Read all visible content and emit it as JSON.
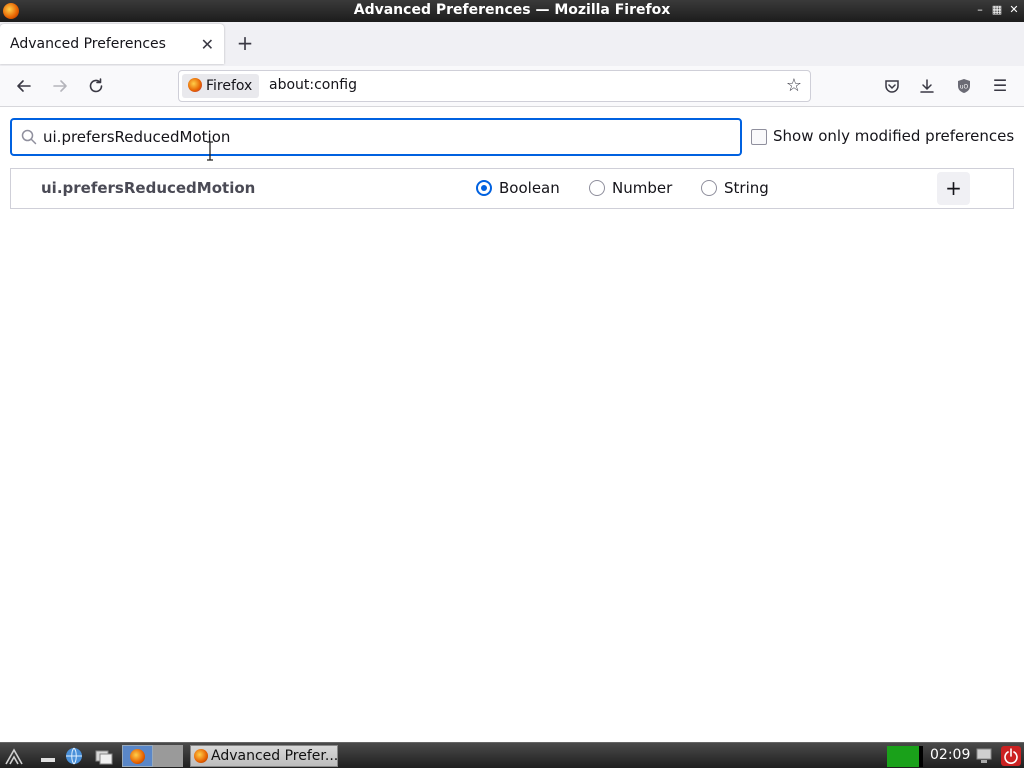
{
  "window": {
    "title": "Advanced Preferences — Mozilla Firefox",
    "controls": [
      "minimize-icon",
      "maximize-icon",
      "close-icon"
    ]
  },
  "tabs": [
    {
      "label": "Advanced Preferences",
      "active": true
    }
  ],
  "newtab_icon": "plus-icon",
  "navbar": {
    "identity_label": "Firefox",
    "url": "about:config",
    "icons": [
      "back-arrow-icon",
      "forward-arrow-icon",
      "reload-icon",
      "bookmark-star-icon",
      "pocket-icon",
      "downloads-icon",
      "ublock-shield-icon",
      "hamburger-menu-icon"
    ]
  },
  "config": {
    "search_value": "ui.prefersReducedMotion",
    "show_modified_label": "Show only modified preferences",
    "show_modified_checked": false,
    "new_pref": {
      "name": "ui.prefersReducedMotion",
      "types": [
        {
          "label": "Boolean",
          "selected": true
        },
        {
          "label": "Number",
          "selected": false
        },
        {
          "label": "String",
          "selected": false
        }
      ],
      "add_label": "+"
    }
  },
  "taskbar": {
    "task_label": "Advanced Prefer...",
    "clock": "02:09"
  },
  "colors": {
    "accent": "#0061e0",
    "titlebar": "#2a2a2a",
    "tray_green": "#1aa11a",
    "power_red": "#cc2222"
  }
}
